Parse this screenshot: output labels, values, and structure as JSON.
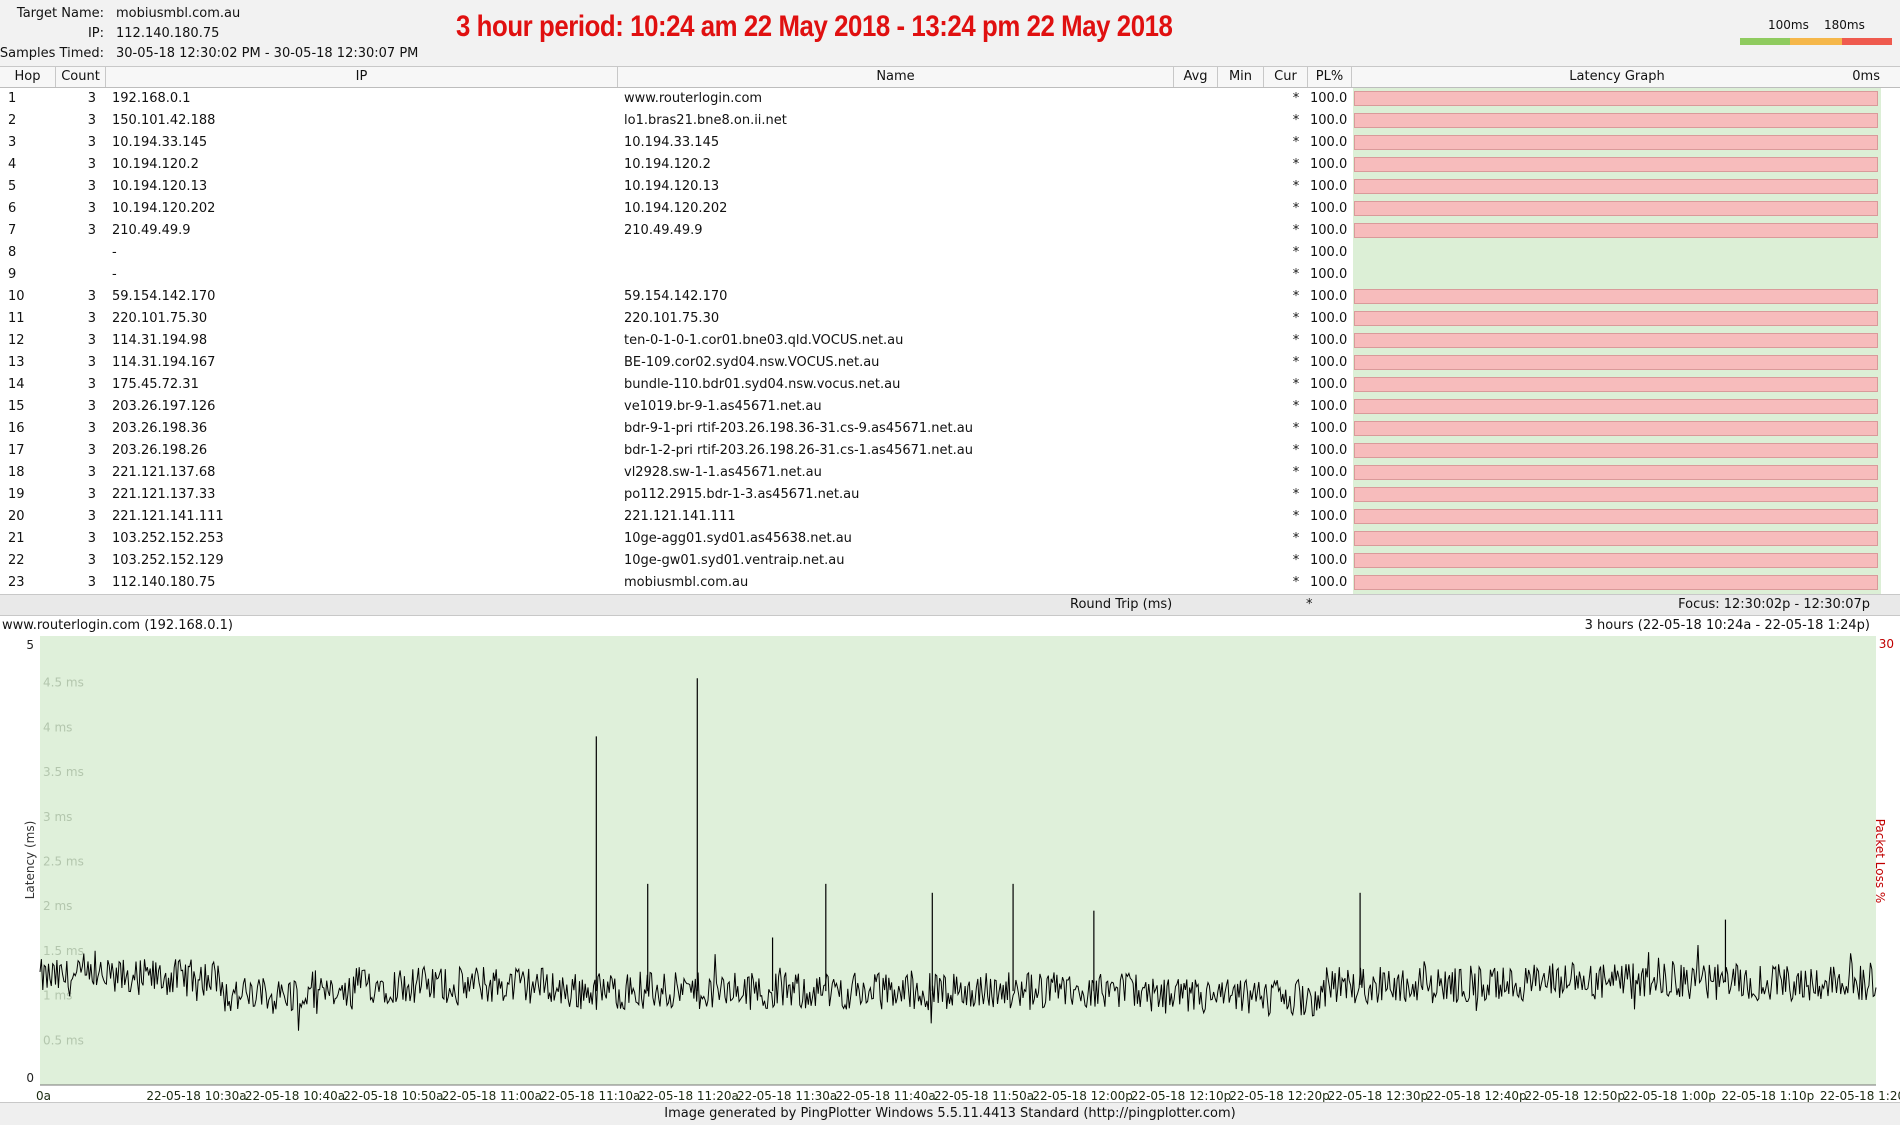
{
  "header": {
    "target_label": "Target Name:",
    "target_value": "mobiusmbl.com.au",
    "ip_label": "IP:",
    "ip_value": "112.140.180.75",
    "samples_label": "Samples Timed:",
    "samples_value": "30-05-18 12:30:02 PM - 30-05-18 12:30:07 PM",
    "period_title": "3 hour period:  10:24 am 22 May 2018 - 13:24 pm 22 May 2018"
  },
  "scale_legend": {
    "label_100": "100ms",
    "label_180": "180ms",
    "colors": [
      "#8fcb5f",
      "#f5b74a",
      "#ef5a4e"
    ]
  },
  "table": {
    "columns": {
      "hop": "Hop",
      "count": "Count",
      "ip": "IP",
      "name": "Name",
      "avg": "Avg",
      "min": "Min",
      "cur": "Cur",
      "pl": "PL%",
      "latency_graph": "Latency Graph",
      "latency_scale": "0ms"
    },
    "rows": [
      {
        "hop": "1",
        "count": "3",
        "ip": "192.168.0.1",
        "name": "www.routerlogin.com",
        "cur": "*",
        "pl": "100.0",
        "lost": true
      },
      {
        "hop": "2",
        "count": "3",
        "ip": "150.101.42.188",
        "name": "lo1.bras21.bne8.on.ii.net",
        "cur": "*",
        "pl": "100.0",
        "lost": true
      },
      {
        "hop": "3",
        "count": "3",
        "ip": "10.194.33.145",
        "name": "10.194.33.145",
        "cur": "*",
        "pl": "100.0",
        "lost": true
      },
      {
        "hop": "4",
        "count": "3",
        "ip": "10.194.120.2",
        "name": "10.194.120.2",
        "cur": "*",
        "pl": "100.0",
        "lost": true
      },
      {
        "hop": "5",
        "count": "3",
        "ip": "10.194.120.13",
        "name": "10.194.120.13",
        "cur": "*",
        "pl": "100.0",
        "lost": true
      },
      {
        "hop": "6",
        "count": "3",
        "ip": "10.194.120.202",
        "name": "10.194.120.202",
        "cur": "*",
        "pl": "100.0",
        "lost": true
      },
      {
        "hop": "7",
        "count": "3",
        "ip": "210.49.49.9",
        "name": "210.49.49.9",
        "cur": "*",
        "pl": "100.0",
        "lost": true
      },
      {
        "hop": "8",
        "count": "",
        "ip": "-",
        "name": "",
        "cur": "*",
        "pl": "100.0",
        "lost": false
      },
      {
        "hop": "9",
        "count": "",
        "ip": "-",
        "name": "",
        "cur": "*",
        "pl": "100.0",
        "lost": false
      },
      {
        "hop": "10",
        "count": "3",
        "ip": "59.154.142.170",
        "name": "59.154.142.170",
        "cur": "*",
        "pl": "100.0",
        "lost": true
      },
      {
        "hop": "11",
        "count": "3",
        "ip": "220.101.75.30",
        "name": "220.101.75.30",
        "cur": "*",
        "pl": "100.0",
        "lost": true
      },
      {
        "hop": "12",
        "count": "3",
        "ip": "114.31.194.98",
        "name": "ten-0-1-0-1.cor01.bne03.qld.VOCUS.net.au",
        "cur": "*",
        "pl": "100.0",
        "lost": true
      },
      {
        "hop": "13",
        "count": "3",
        "ip": "114.31.194.167",
        "name": "BE-109.cor02.syd04.nsw.VOCUS.net.au",
        "cur": "*",
        "pl": "100.0",
        "lost": true
      },
      {
        "hop": "14",
        "count": "3",
        "ip": "175.45.72.31",
        "name": "bundle-110.bdr01.syd04.nsw.vocus.net.au",
        "cur": "*",
        "pl": "100.0",
        "lost": true
      },
      {
        "hop": "15",
        "count": "3",
        "ip": "203.26.197.126",
        "name": "ve1019.br-9-1.as45671.net.au",
        "cur": "*",
        "pl": "100.0",
        "lost": true
      },
      {
        "hop": "16",
        "count": "3",
        "ip": "203.26.198.36",
        "name": "bdr-9-1-pri rtif-203.26.198.36-31.cs-9.as45671.net.au",
        "cur": "*",
        "pl": "100.0",
        "lost": true
      },
      {
        "hop": "17",
        "count": "3",
        "ip": "203.26.198.26",
        "name": "bdr-1-2-pri rtif-203.26.198.26-31.cs-1.as45671.net.au",
        "cur": "*",
        "pl": "100.0",
        "lost": true
      },
      {
        "hop": "18",
        "count": "3",
        "ip": "221.121.137.68",
        "name": "vl2928.sw-1-1.as45671.net.au",
        "cur": "*",
        "pl": "100.0",
        "lost": true
      },
      {
        "hop": "19",
        "count": "3",
        "ip": "221.121.137.33",
        "name": "po112.2915.bdr-1-3.as45671.net.au",
        "cur": "*",
        "pl": "100.0",
        "lost": true
      },
      {
        "hop": "20",
        "count": "3",
        "ip": "221.121.141.111",
        "name": "221.121.141.111",
        "cur": "*",
        "pl": "100.0",
        "lost": true
      },
      {
        "hop": "21",
        "count": "3",
        "ip": "103.252.152.253",
        "name": "10ge-agg01.syd01.as45638.net.au",
        "cur": "*",
        "pl": "100.0",
        "lost": true
      },
      {
        "hop": "22",
        "count": "3",
        "ip": "103.252.152.129",
        "name": "10ge-gw01.syd01.ventraip.net.au",
        "cur": "*",
        "pl": "100.0",
        "lost": true
      },
      {
        "hop": "23",
        "count": "3",
        "ip": "112.140.180.75",
        "name": "mobiusmbl.com.au",
        "cur": "*",
        "pl": "100.0",
        "lost": true
      }
    ],
    "roundtrip_label": "Round Trip (ms)",
    "roundtrip_cur": "*",
    "focus": "Focus: 12:30:02p - 12:30:07p"
  },
  "graph": {
    "title": "www.routerlogin.com (192.168.0.1)",
    "range_label": "3 hours (22-05-18 10:24a - 22-05-18 1:24p)",
    "right_axis_max": "30",
    "y_axis_label": "Latency (ms)",
    "right_axis_label": "Packet Loss %",
    "colors": {
      "background": "#dff0da",
      "line": "#000000",
      "loss": "#c00000",
      "grid_text": "#b3c6ad"
    }
  },
  "chart_data": {
    "type": "line",
    "xlabel": "",
    "ylabel": "Latency (ms)",
    "ylim": [
      0,
      5
    ],
    "y_ticks": [
      "0.5 ms",
      "1 ms",
      "1.5 ms",
      "2 ms",
      "2.5 ms",
      "3 ms",
      "3.5 ms",
      "4 ms",
      "4.5 ms"
    ],
    "y_axis_ends": [
      "0",
      "5"
    ],
    "x_ticks": [
      "0a",
      "22-05-18 10:30a",
      "22-05-18 10:40a",
      "22-05-18 10:50a",
      "22-05-18 11:00a",
      "22-05-18 11:10a",
      "22-05-18 11:20a",
      "22-05-18 11:30a",
      "22-05-18 11:40a",
      "22-05-18 11:50a",
      "22-05-18 12:00p",
      "22-05-18 12:10p",
      "22-05-18 12:20p",
      "22-05-18 12:30p",
      "22-05-18 12:40p",
      "22-05-18 12:50p",
      "22-05-18 1:00p",
      "22-05-18 1:10p",
      "22-05-18 1:20"
    ],
    "baseline_segments": [
      {
        "from": 0.0,
        "to": 0.1,
        "level": 1.2
      },
      {
        "from": 0.1,
        "to": 0.17,
        "level": 1.0
      },
      {
        "from": 0.17,
        "to": 0.28,
        "level": 1.12
      },
      {
        "from": 0.28,
        "to": 0.6,
        "level": 1.05
      },
      {
        "from": 0.6,
        "to": 0.7,
        "level": 0.98
      },
      {
        "from": 0.7,
        "to": 0.8,
        "level": 1.12
      },
      {
        "from": 0.8,
        "to": 1.0,
        "level": 1.15
      }
    ],
    "spikes": [
      {
        "pos": 0.303,
        "value": 3.9
      },
      {
        "pos": 0.331,
        "value": 2.25
      },
      {
        "pos": 0.358,
        "value": 4.55
      },
      {
        "pos": 0.399,
        "value": 1.65
      },
      {
        "pos": 0.428,
        "value": 2.25
      },
      {
        "pos": 0.486,
        "value": 2.15
      },
      {
        "pos": 0.53,
        "value": 2.25
      },
      {
        "pos": 0.574,
        "value": 1.95
      },
      {
        "pos": 0.719,
        "value": 2.15
      },
      {
        "pos": 0.918,
        "value": 1.85
      }
    ],
    "series": [
      {
        "values_note_only": null
      }
    ]
  },
  "footer": {
    "text": "Image generated by PingPlotter Windows 5.5.11.4413 Standard (http://pingplotter.com)"
  }
}
